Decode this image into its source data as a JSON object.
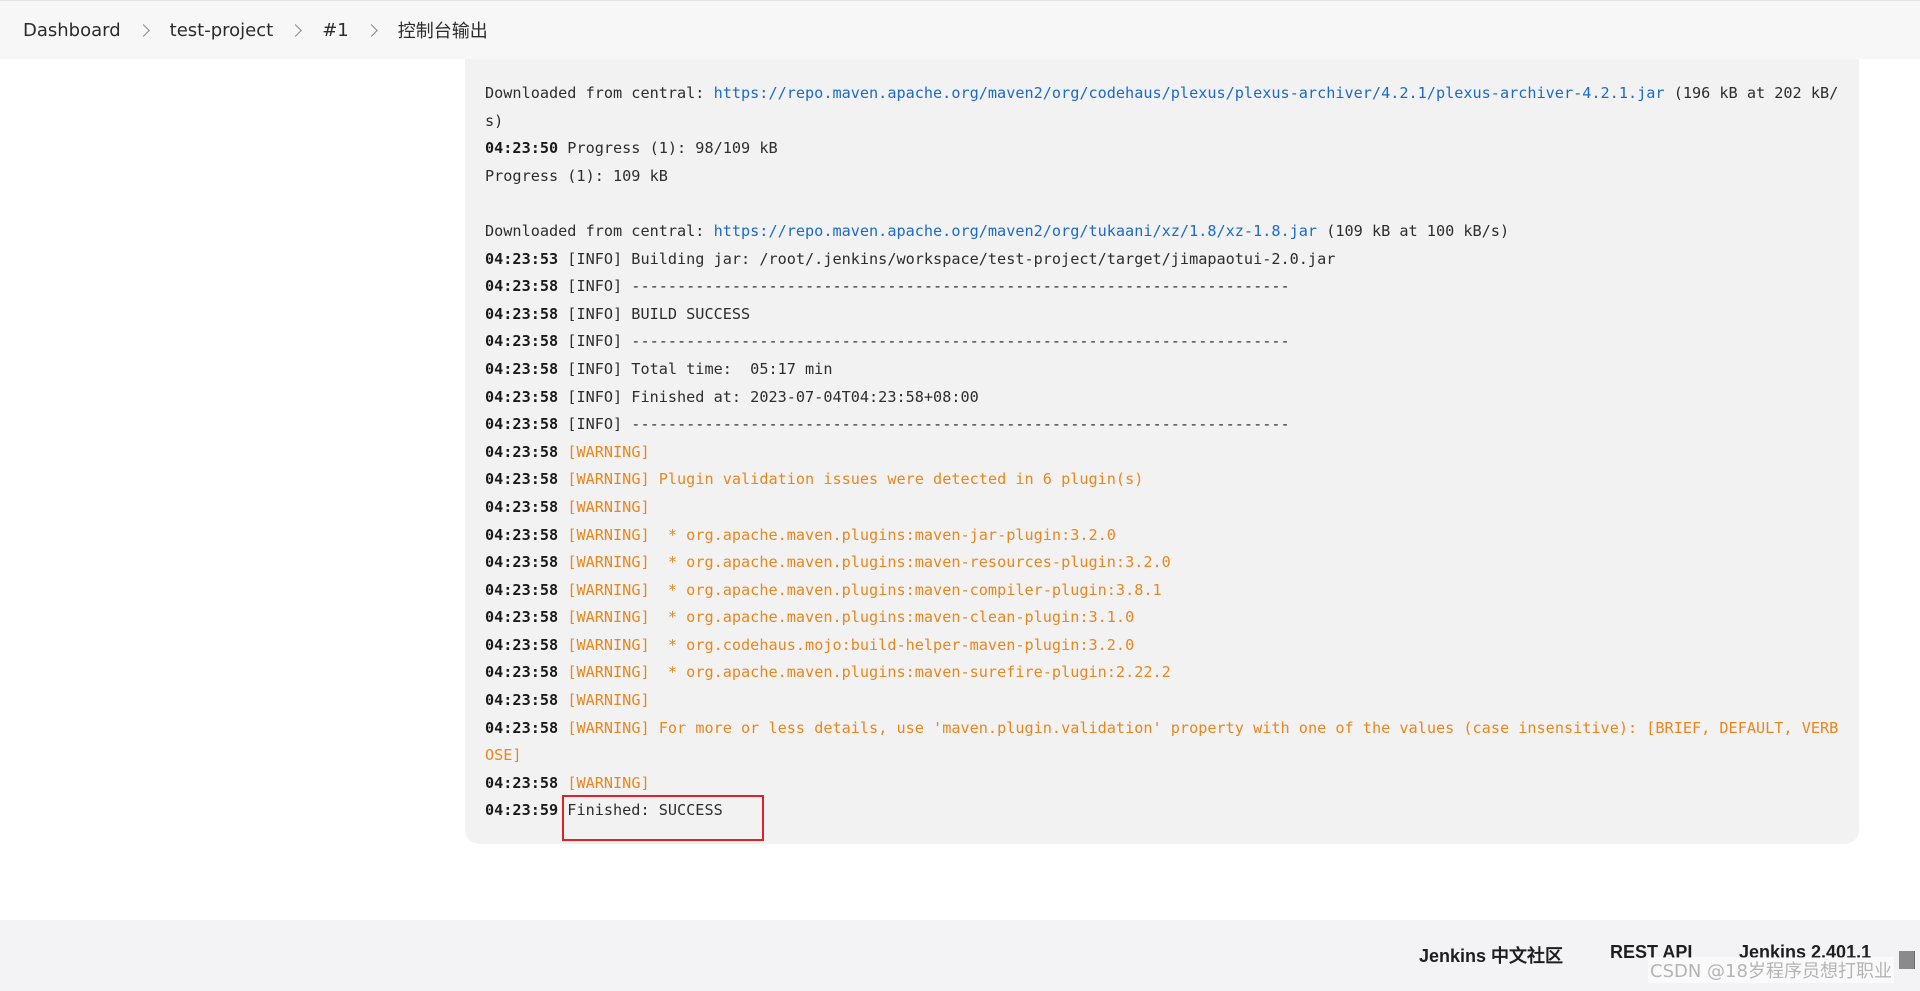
{
  "breadcrumb": {
    "items": [
      "Dashboard",
      "test-project",
      "#1",
      "控制台输出"
    ]
  },
  "console": {
    "lines": [
      {
        "text": "Downloaded from central: ",
        "link": "https://repo.maven.apache.org/maven2/org/codehaus/plexus/plexus-archiver/4.2.1/plexus-archiver-4.2.1.jar",
        "after": " (196 kB at 202 kB/s)"
      },
      {
        "ts": "04:23:50",
        "text": " Progress (1): 98/109 kB"
      },
      {
        "text": "Progress (1): 109 kB"
      },
      {
        "blank": true
      },
      {
        "text": "Downloaded from central: ",
        "link": "https://repo.maven.apache.org/maven2/org/tukaani/xz/1.8/xz-1.8.jar",
        "after": " (109 kB at 100 kB/s)"
      },
      {
        "ts": "04:23:53",
        "text": " [INFO] Building jar: /root/.jenkins/workspace/test-project/target/jimapaotui-2.0.jar"
      },
      {
        "ts": "04:23:58",
        "text": " [INFO] ------------------------------------------------------------------------"
      },
      {
        "ts": "04:23:58",
        "text": " [INFO] BUILD SUCCESS"
      },
      {
        "ts": "04:23:58",
        "text": " [INFO] ------------------------------------------------------------------------"
      },
      {
        "ts": "04:23:58",
        "text": " [INFO] Total time:  05:17 min"
      },
      {
        "ts": "04:23:58",
        "text": " [INFO] Finished at: 2023-07-04T04:23:58+08:00"
      },
      {
        "ts": "04:23:58",
        "text": " [INFO] ------------------------------------------------------------------------"
      },
      {
        "ts": "04:23:58",
        "warn": "[WARNING]"
      },
      {
        "ts": "04:23:58",
        "warn": "[WARNING] Plugin validation issues were detected in 6 plugin(s)"
      },
      {
        "ts": "04:23:58",
        "warn": "[WARNING]"
      },
      {
        "ts": "04:23:58",
        "warn": "[WARNING]  * org.apache.maven.plugins:maven-jar-plugin:3.2.0"
      },
      {
        "ts": "04:23:58",
        "warn": "[WARNING]  * org.apache.maven.plugins:maven-resources-plugin:3.2.0"
      },
      {
        "ts": "04:23:58",
        "warn": "[WARNING]  * org.apache.maven.plugins:maven-compiler-plugin:3.8.1"
      },
      {
        "ts": "04:23:58",
        "warn": "[WARNING]  * org.apache.maven.plugins:maven-clean-plugin:3.1.0"
      },
      {
        "ts": "04:23:58",
        "warn": "[WARNING]  * org.codehaus.mojo:build-helper-maven-plugin:3.2.0"
      },
      {
        "ts": "04:23:58",
        "warn": "[WARNING]  * org.apache.maven.plugins:maven-surefire-plugin:2.22.2"
      },
      {
        "ts": "04:23:58",
        "warn": "[WARNING]"
      },
      {
        "ts": "04:23:58",
        "warn": "[WARNING] For more or less details, use 'maven.plugin.validation' property with one of the values (case insensitive): [BRIEF, DEFAULT, VERBOSE]"
      },
      {
        "ts": "04:23:58",
        "warn": "[WARNING]"
      },
      {
        "ts": "04:23:59",
        "text": " Finished: SUCCESS",
        "highlight": true
      }
    ]
  },
  "footer": {
    "community": "Jenkins 中文社区",
    "rest_api": "REST API",
    "version": "Jenkins 2.401.1"
  },
  "watermark": "CSDN @18岁程序员想打职业",
  "colors": {
    "warning": "#e8871e",
    "link": "#1b6ac9",
    "highlight_border": "#e0212a",
    "console_bg": "#f2f2f2"
  }
}
